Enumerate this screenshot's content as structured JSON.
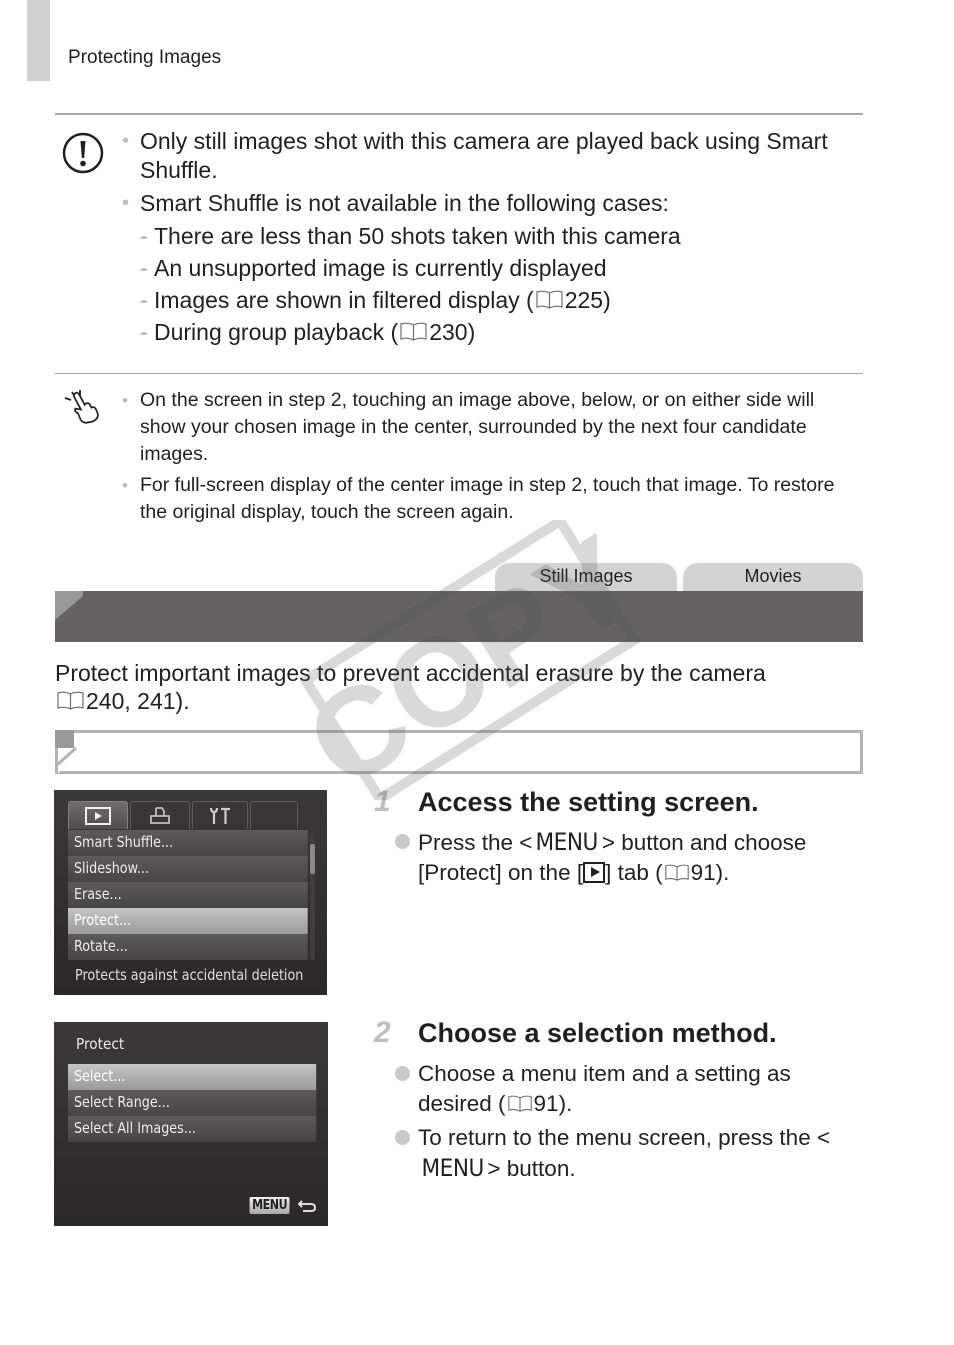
{
  "header": {
    "running_title": "Protecting Images"
  },
  "caution": {
    "icon": "caution-icon",
    "bullets": [
      "Only still images shot with this camera are played back using Smart Shuffle.",
      "Smart Shuffle is not available in the following cases:"
    ],
    "cases": [
      {
        "text": "There are less than 50 shots taken with this camera",
        "ref": ""
      },
      {
        "text": "An unsupported image is currently displayed",
        "ref": ""
      },
      {
        "text": "Images are shown in filtered display (",
        "ref": "225",
        "suffix": ")"
      },
      {
        "text": "During group playback (",
        "ref": "230",
        "suffix": ")"
      }
    ]
  },
  "touch_note": {
    "icon": "touch-hand-icon",
    "bullets": [
      "On the screen in step 2, touching an image above, below, or on either side will show your chosen image in the center, surrounded by the next four candidate images.",
      "For full-screen display of the center image in step 2, touch that image. To restore the original display, touch the screen again."
    ]
  },
  "section": {
    "tabs": [
      "Still Images",
      "Movies"
    ],
    "title": "",
    "intro_text": "Protect important images to prevent accidental erasure by the camera",
    "intro_ref_prefix": "(",
    "intro_ref": "240, 241).",
    "subheading": ""
  },
  "screen1": {
    "tabs": [
      "playback-tab-icon",
      "print-tab-icon",
      "setup-tab-icon"
    ],
    "items": [
      "Smart Shuffle...",
      "Slideshow...",
      "Erase...",
      "Protect...",
      "Rotate..."
    ],
    "selected_index": 3,
    "hint": "Protects against accidental deletion"
  },
  "screen2": {
    "title": "Protect",
    "items": [
      "Select...",
      "Select Range...",
      "Select All Images..."
    ],
    "selected_index": 0,
    "back_badge": "MENU"
  },
  "steps": [
    {
      "number": "1",
      "title": "Access the setting screen.",
      "bullets": [
        {
          "pre": "Press the <",
          "menu": "MENU",
          "mid": "> button and choose [Protect] on the [",
          "post": "] tab (",
          "ref": "91",
          "end": ")."
        }
      ]
    },
    {
      "number": "2",
      "title": "Choose a selection method.",
      "bullets": [
        {
          "pre": "Choose a menu item and a setting as desired (",
          "ref": "91",
          "end": ")."
        },
        {
          "pre": "To return to the menu screen, press the <",
          "menu": "MENU",
          "end": "> button."
        }
      ]
    }
  ],
  "watermark": "COPY"
}
